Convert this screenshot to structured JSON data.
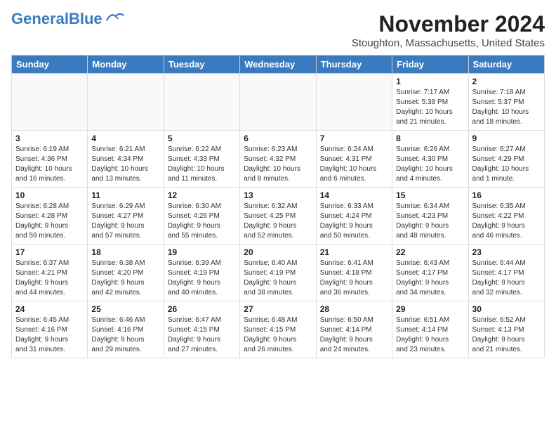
{
  "header": {
    "logo_line1": "General",
    "logo_line2": "Blue",
    "month_title": "November 2024",
    "location": "Stoughton, Massachusetts, United States"
  },
  "weekdays": [
    "Sunday",
    "Monday",
    "Tuesday",
    "Wednesday",
    "Thursday",
    "Friday",
    "Saturday"
  ],
  "weeks": [
    [
      {
        "day": "",
        "info": ""
      },
      {
        "day": "",
        "info": ""
      },
      {
        "day": "",
        "info": ""
      },
      {
        "day": "",
        "info": ""
      },
      {
        "day": "",
        "info": ""
      },
      {
        "day": "1",
        "info": "Sunrise: 7:17 AM\nSunset: 5:38 PM\nDaylight: 10 hours\nand 21 minutes."
      },
      {
        "day": "2",
        "info": "Sunrise: 7:18 AM\nSunset: 5:37 PM\nDaylight: 10 hours\nand 18 minutes."
      }
    ],
    [
      {
        "day": "3",
        "info": "Sunrise: 6:19 AM\nSunset: 4:36 PM\nDaylight: 10 hours\nand 16 minutes."
      },
      {
        "day": "4",
        "info": "Sunrise: 6:21 AM\nSunset: 4:34 PM\nDaylight: 10 hours\nand 13 minutes."
      },
      {
        "day": "5",
        "info": "Sunrise: 6:22 AM\nSunset: 4:33 PM\nDaylight: 10 hours\nand 11 minutes."
      },
      {
        "day": "6",
        "info": "Sunrise: 6:23 AM\nSunset: 4:32 PM\nDaylight: 10 hours\nand 8 minutes."
      },
      {
        "day": "7",
        "info": "Sunrise: 6:24 AM\nSunset: 4:31 PM\nDaylight: 10 hours\nand 6 minutes."
      },
      {
        "day": "8",
        "info": "Sunrise: 6:26 AM\nSunset: 4:30 PM\nDaylight: 10 hours\nand 4 minutes."
      },
      {
        "day": "9",
        "info": "Sunrise: 6:27 AM\nSunset: 4:29 PM\nDaylight: 10 hours\nand 1 minute."
      }
    ],
    [
      {
        "day": "10",
        "info": "Sunrise: 6:28 AM\nSunset: 4:28 PM\nDaylight: 9 hours\nand 59 minutes."
      },
      {
        "day": "11",
        "info": "Sunrise: 6:29 AM\nSunset: 4:27 PM\nDaylight: 9 hours\nand 57 minutes."
      },
      {
        "day": "12",
        "info": "Sunrise: 6:30 AM\nSunset: 4:26 PM\nDaylight: 9 hours\nand 55 minutes."
      },
      {
        "day": "13",
        "info": "Sunrise: 6:32 AM\nSunset: 4:25 PM\nDaylight: 9 hours\nand 52 minutes."
      },
      {
        "day": "14",
        "info": "Sunrise: 6:33 AM\nSunset: 4:24 PM\nDaylight: 9 hours\nand 50 minutes."
      },
      {
        "day": "15",
        "info": "Sunrise: 6:34 AM\nSunset: 4:23 PM\nDaylight: 9 hours\nand 48 minutes."
      },
      {
        "day": "16",
        "info": "Sunrise: 6:35 AM\nSunset: 4:22 PM\nDaylight: 9 hours\nand 46 minutes."
      }
    ],
    [
      {
        "day": "17",
        "info": "Sunrise: 6:37 AM\nSunset: 4:21 PM\nDaylight: 9 hours\nand 44 minutes."
      },
      {
        "day": "18",
        "info": "Sunrise: 6:38 AM\nSunset: 4:20 PM\nDaylight: 9 hours\nand 42 minutes."
      },
      {
        "day": "19",
        "info": "Sunrise: 6:39 AM\nSunset: 4:19 PM\nDaylight: 9 hours\nand 40 minutes."
      },
      {
        "day": "20",
        "info": "Sunrise: 6:40 AM\nSunset: 4:19 PM\nDaylight: 9 hours\nand 38 minutes."
      },
      {
        "day": "21",
        "info": "Sunrise: 6:41 AM\nSunset: 4:18 PM\nDaylight: 9 hours\nand 36 minutes."
      },
      {
        "day": "22",
        "info": "Sunrise: 6:43 AM\nSunset: 4:17 PM\nDaylight: 9 hours\nand 34 minutes."
      },
      {
        "day": "23",
        "info": "Sunrise: 6:44 AM\nSunset: 4:17 PM\nDaylight: 9 hours\nand 32 minutes."
      }
    ],
    [
      {
        "day": "24",
        "info": "Sunrise: 6:45 AM\nSunset: 4:16 PM\nDaylight: 9 hours\nand 31 minutes."
      },
      {
        "day": "25",
        "info": "Sunrise: 6:46 AM\nSunset: 4:16 PM\nDaylight: 9 hours\nand 29 minutes."
      },
      {
        "day": "26",
        "info": "Sunrise: 6:47 AM\nSunset: 4:15 PM\nDaylight: 9 hours\nand 27 minutes."
      },
      {
        "day": "27",
        "info": "Sunrise: 6:48 AM\nSunset: 4:15 PM\nDaylight: 9 hours\nand 26 minutes."
      },
      {
        "day": "28",
        "info": "Sunrise: 6:50 AM\nSunset: 4:14 PM\nDaylight: 9 hours\nand 24 minutes."
      },
      {
        "day": "29",
        "info": "Sunrise: 6:51 AM\nSunset: 4:14 PM\nDaylight: 9 hours\nand 23 minutes."
      },
      {
        "day": "30",
        "info": "Sunrise: 6:52 AM\nSunset: 4:13 PM\nDaylight: 9 hours\nand 21 minutes."
      }
    ]
  ]
}
